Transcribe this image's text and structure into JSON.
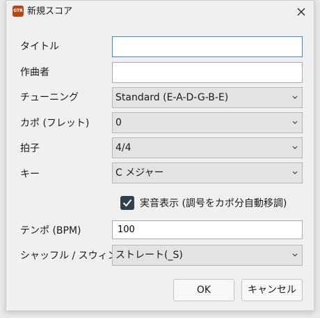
{
  "window": {
    "title": "新規スコア",
    "icon_text": "GTR",
    "icon_color": "#b24a17"
  },
  "form": {
    "title": {
      "label": "タイトル",
      "value": ""
    },
    "composer": {
      "label": "作曲者",
      "value": ""
    },
    "tuning": {
      "label": "チューニング",
      "value": "Standard (E-A-D-G-B-E)"
    },
    "capo": {
      "label": "カポ (フレット)",
      "value": "0"
    },
    "time_signature": {
      "label": "拍子",
      "value": "4/4"
    },
    "key": {
      "label": "キー",
      "value": "C メジャー"
    },
    "concert_pitch": {
      "label": "実音表示 (調号をカポ分自動移調)",
      "checked": true
    },
    "tempo": {
      "label": "テンポ (BPM)",
      "value": "100"
    },
    "feel": {
      "label": "シャッフル / スウィング",
      "value": "ストレート(_S)"
    }
  },
  "buttons": {
    "ok": "OK",
    "cancel": "キャンセル"
  }
}
